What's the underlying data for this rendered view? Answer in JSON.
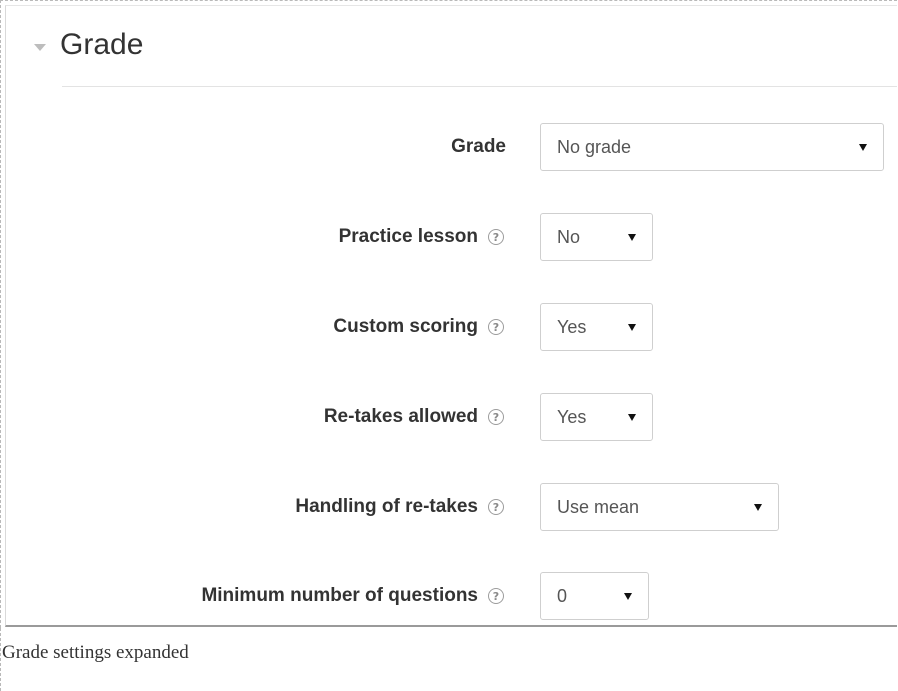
{
  "section": {
    "title": "Grade"
  },
  "fields": [
    {
      "label": "Grade",
      "value": "No grade",
      "help": false
    },
    {
      "label": "Practice lesson",
      "value": "No",
      "help": true
    },
    {
      "label": "Custom scoring",
      "value": "Yes",
      "help": true
    },
    {
      "label": "Re-takes allowed",
      "value": "Yes",
      "help": true
    },
    {
      "label": "Handling of re-takes",
      "value": "Use mean",
      "help": true
    },
    {
      "label": "Minimum number of questions",
      "value": "0",
      "help": true
    }
  ],
  "help_glyph": "?",
  "caption": "Grade settings expanded"
}
